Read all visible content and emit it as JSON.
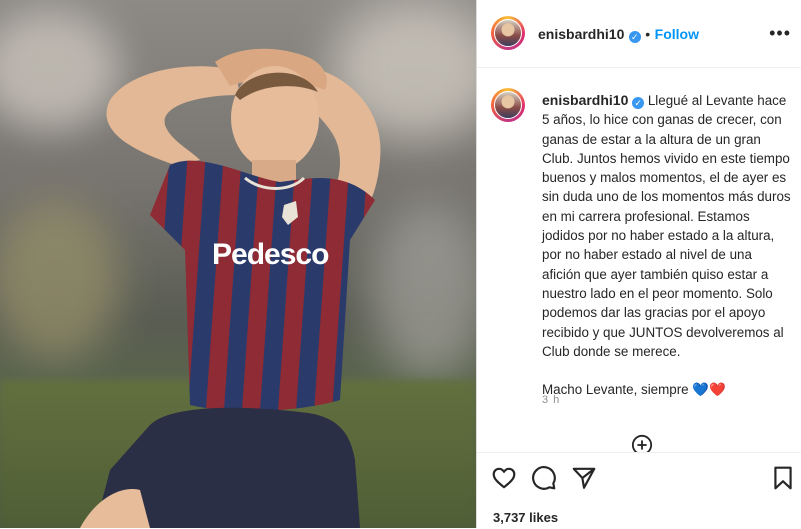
{
  "post": {
    "username": "enisbardhi10",
    "verified_mark": "✓",
    "separator": "•",
    "follow_label": "Follow",
    "more_label": "•••",
    "caption_body": "Llegué al Levante hace 5 años, lo hice con ganas de crecer, con ganas de estar a la altura de un gran Club. Juntos hemos vivido en este tiempo buenos y malos momentos, el de ayer es sin duda uno de los momentos más duros en mi carrera profesional. Estamos jodidos por no haber estado a la altura, por no haber estado al nivel de una afición que ayer también quiso estar a nuestro lado en el peor momento. Solo podemos dar las gracias por el apoyo recibido y que JUNTOS devolveremos al Club donde se merece.",
    "caption_sign": "Macho Levante, siempre 💙❤️",
    "time_ago": "3 h",
    "likes": "3,737 likes"
  },
  "photo": {
    "shirt_sponsor": "Pedesco"
  },
  "icons": {
    "like": "heart-icon",
    "comment": "comment-icon",
    "share": "paper-plane-icon",
    "save": "bookmark-icon",
    "add_comment": "add-circle-icon",
    "more": "more-dots-icon"
  },
  "colors": {
    "follow": "#0095f6",
    "verified": "#3897f0",
    "text": "#262626",
    "muted": "#8e8e8e",
    "shirt_blue": "#2a3a6b",
    "shirt_red": "#8e2b35"
  }
}
